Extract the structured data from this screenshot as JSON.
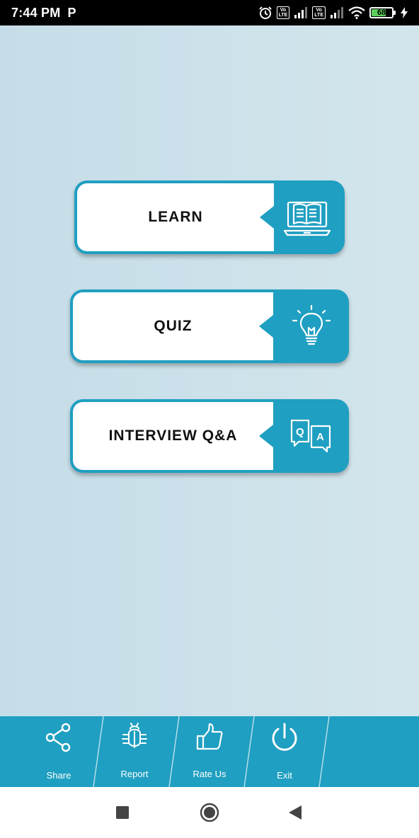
{
  "status_bar": {
    "time": "7:44 PM",
    "app_indicator": "P",
    "volte_label_1": "Vo\nLTE",
    "volte_label_2": "Vo\nLTE",
    "battery_level": "68",
    "battery_fraction": 0.68
  },
  "menu": {
    "items": [
      {
        "label": "LEARN",
        "icon": "book-laptop-icon"
      },
      {
        "label": "QUIZ",
        "icon": "lightbulb-icon"
      },
      {
        "label": "INTERVIEW Q&A",
        "icon": "qa-icon"
      }
    ]
  },
  "bottom_bar": {
    "items": [
      {
        "label": "Share",
        "icon": "share-icon"
      },
      {
        "label": "Report",
        "icon": "bug-icon"
      },
      {
        "label": "Rate Us",
        "icon": "thumbs-up-icon"
      },
      {
        "label": "Exit",
        "icon": "power-icon"
      }
    ]
  },
  "colors": {
    "accent": "#1f9fc1",
    "background": "#c9e0ea",
    "card": "#ffffff"
  }
}
